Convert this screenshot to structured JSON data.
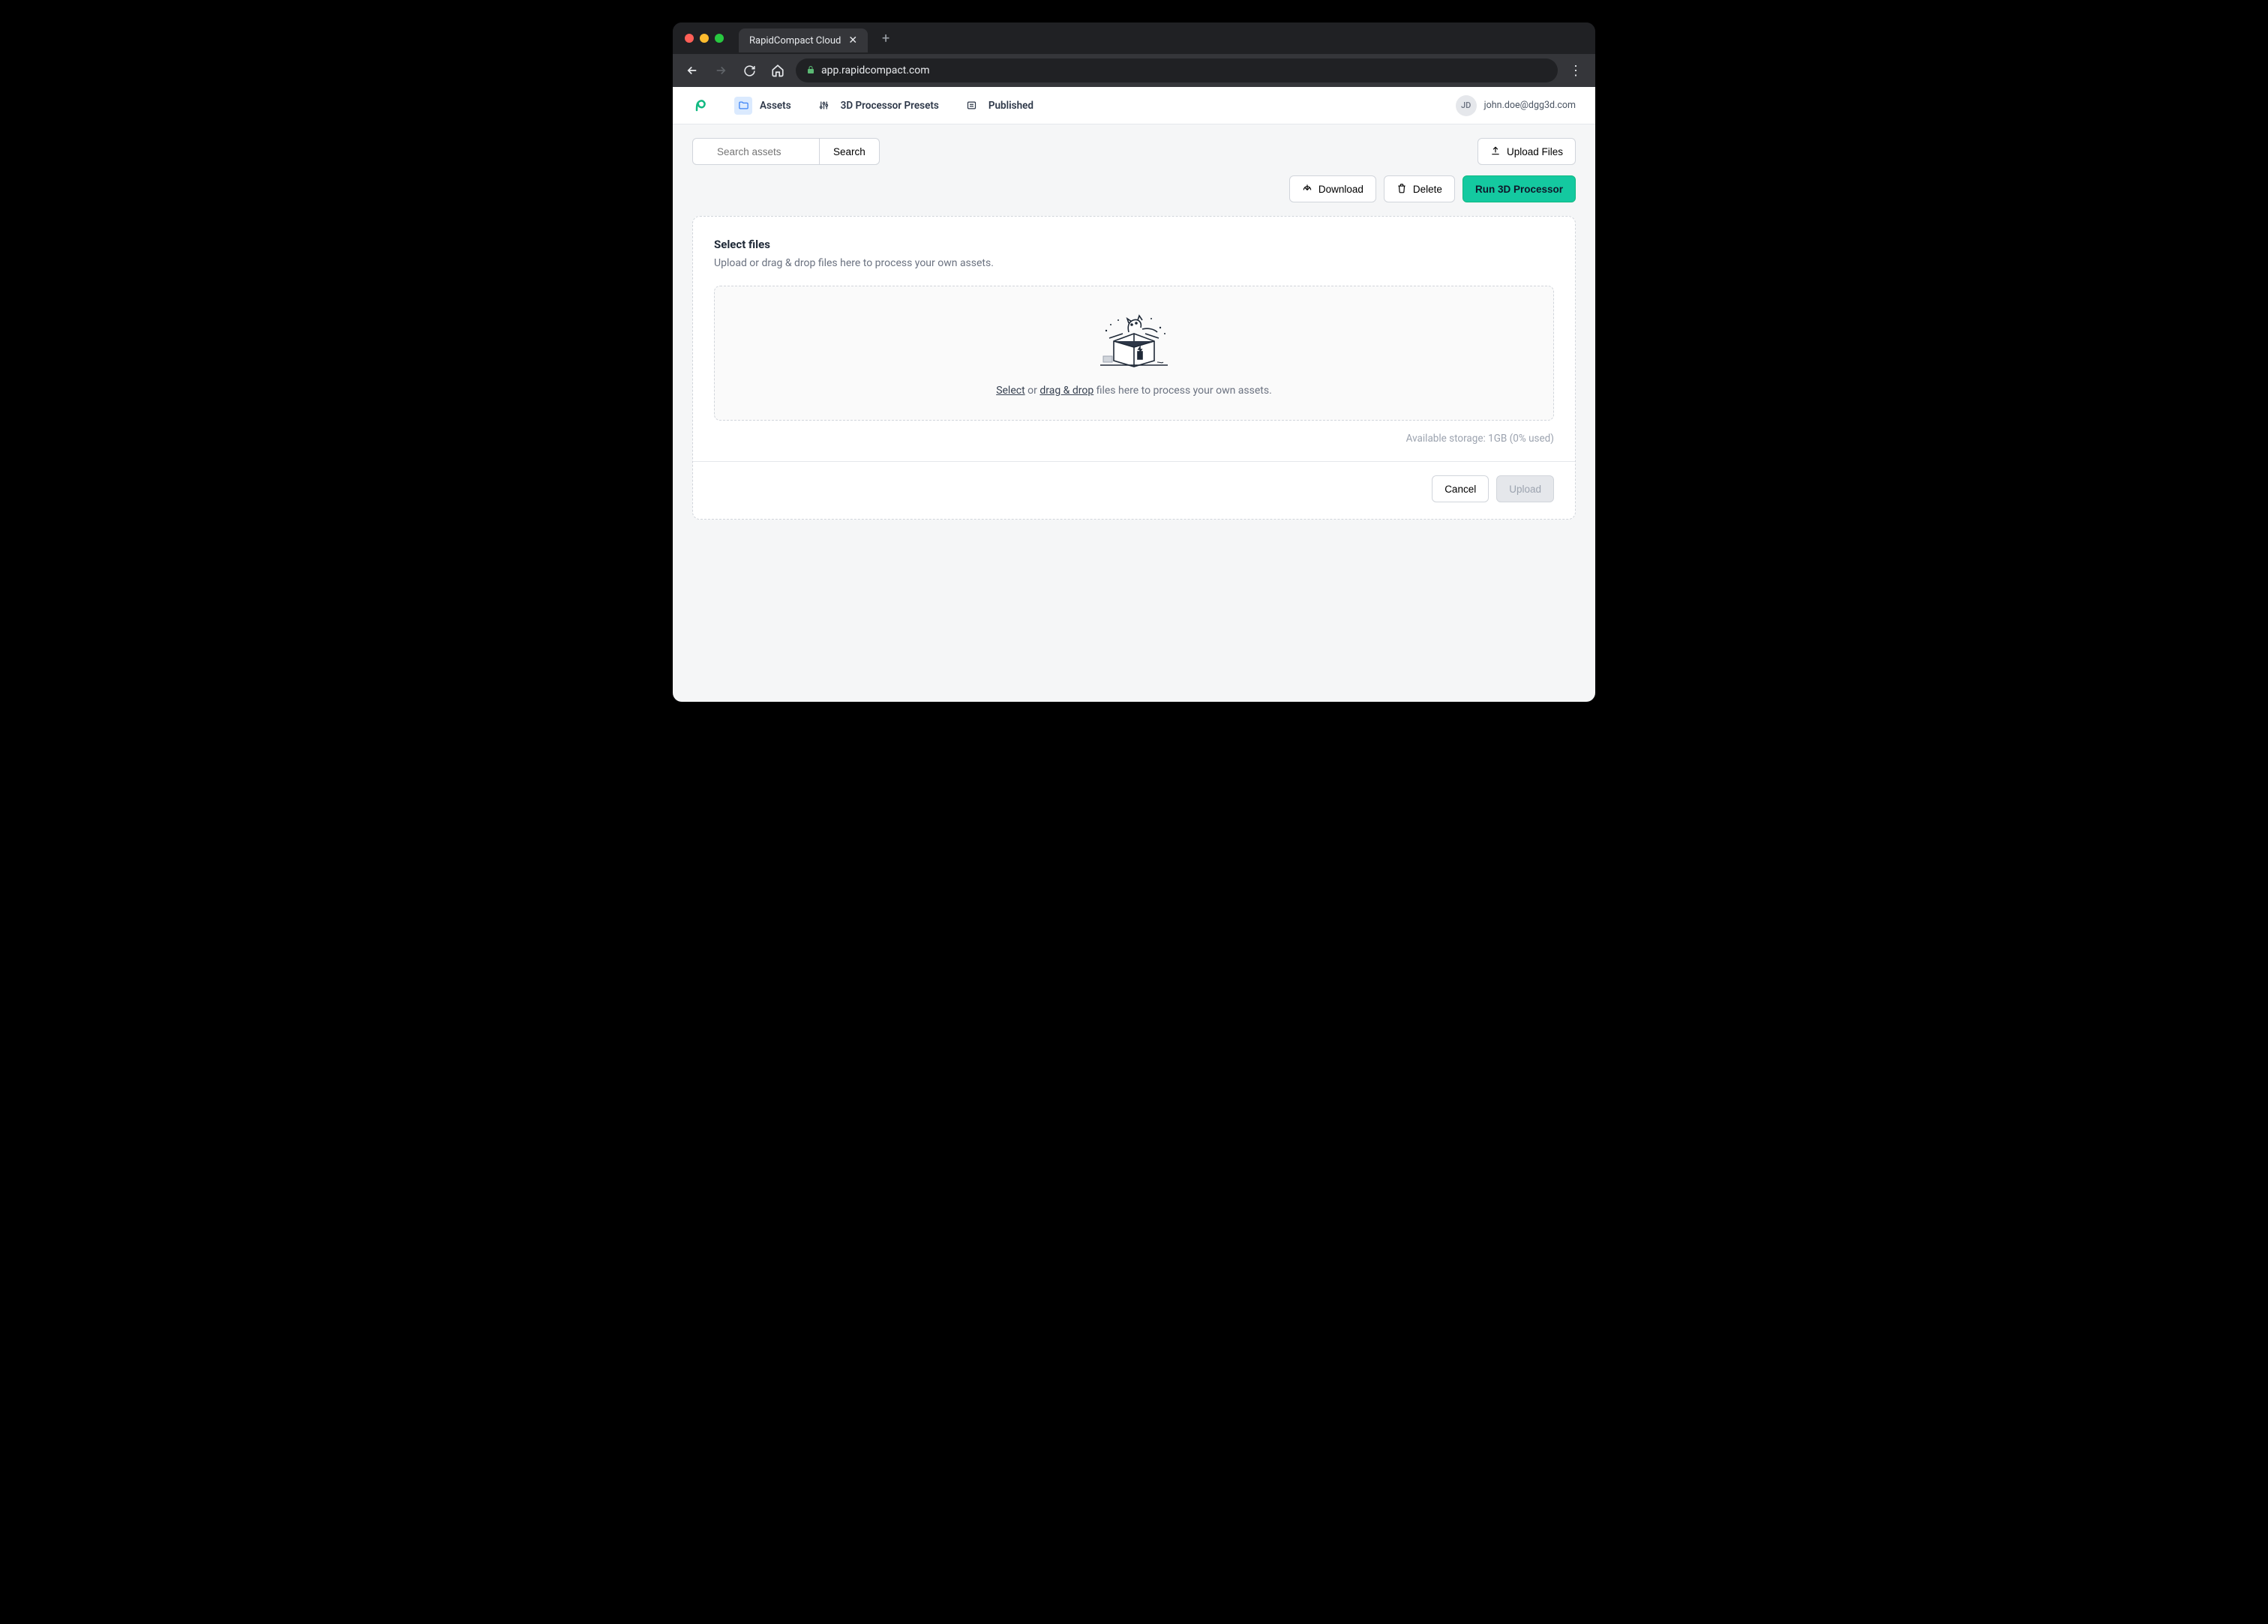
{
  "browser": {
    "tab_title": "RapidCompact Cloud",
    "url": "app.rapidcompact.com"
  },
  "header": {
    "nav": {
      "assets": "Assets",
      "presets": "3D Processor Presets",
      "published": "Published"
    },
    "user": {
      "initials": "JD",
      "email": "john.doe@dgg3d.com"
    }
  },
  "toolbar": {
    "search_placeholder": "Search assets",
    "search_button": "Search",
    "upload_files": "Upload Files",
    "download": "Download",
    "delete": "Delete",
    "run_processor": "Run 3D Processor"
  },
  "panel": {
    "title": "Select files",
    "subtitle": "Upload or drag & drop files here to process your own assets.",
    "dz_select": "Select",
    "dz_or": " or ",
    "dz_drag": "drag & drop",
    "dz_suffix": " files here to process your own assets.",
    "storage": "Available storage: 1GB (0% used)",
    "cancel": "Cancel",
    "upload": "Upload"
  }
}
